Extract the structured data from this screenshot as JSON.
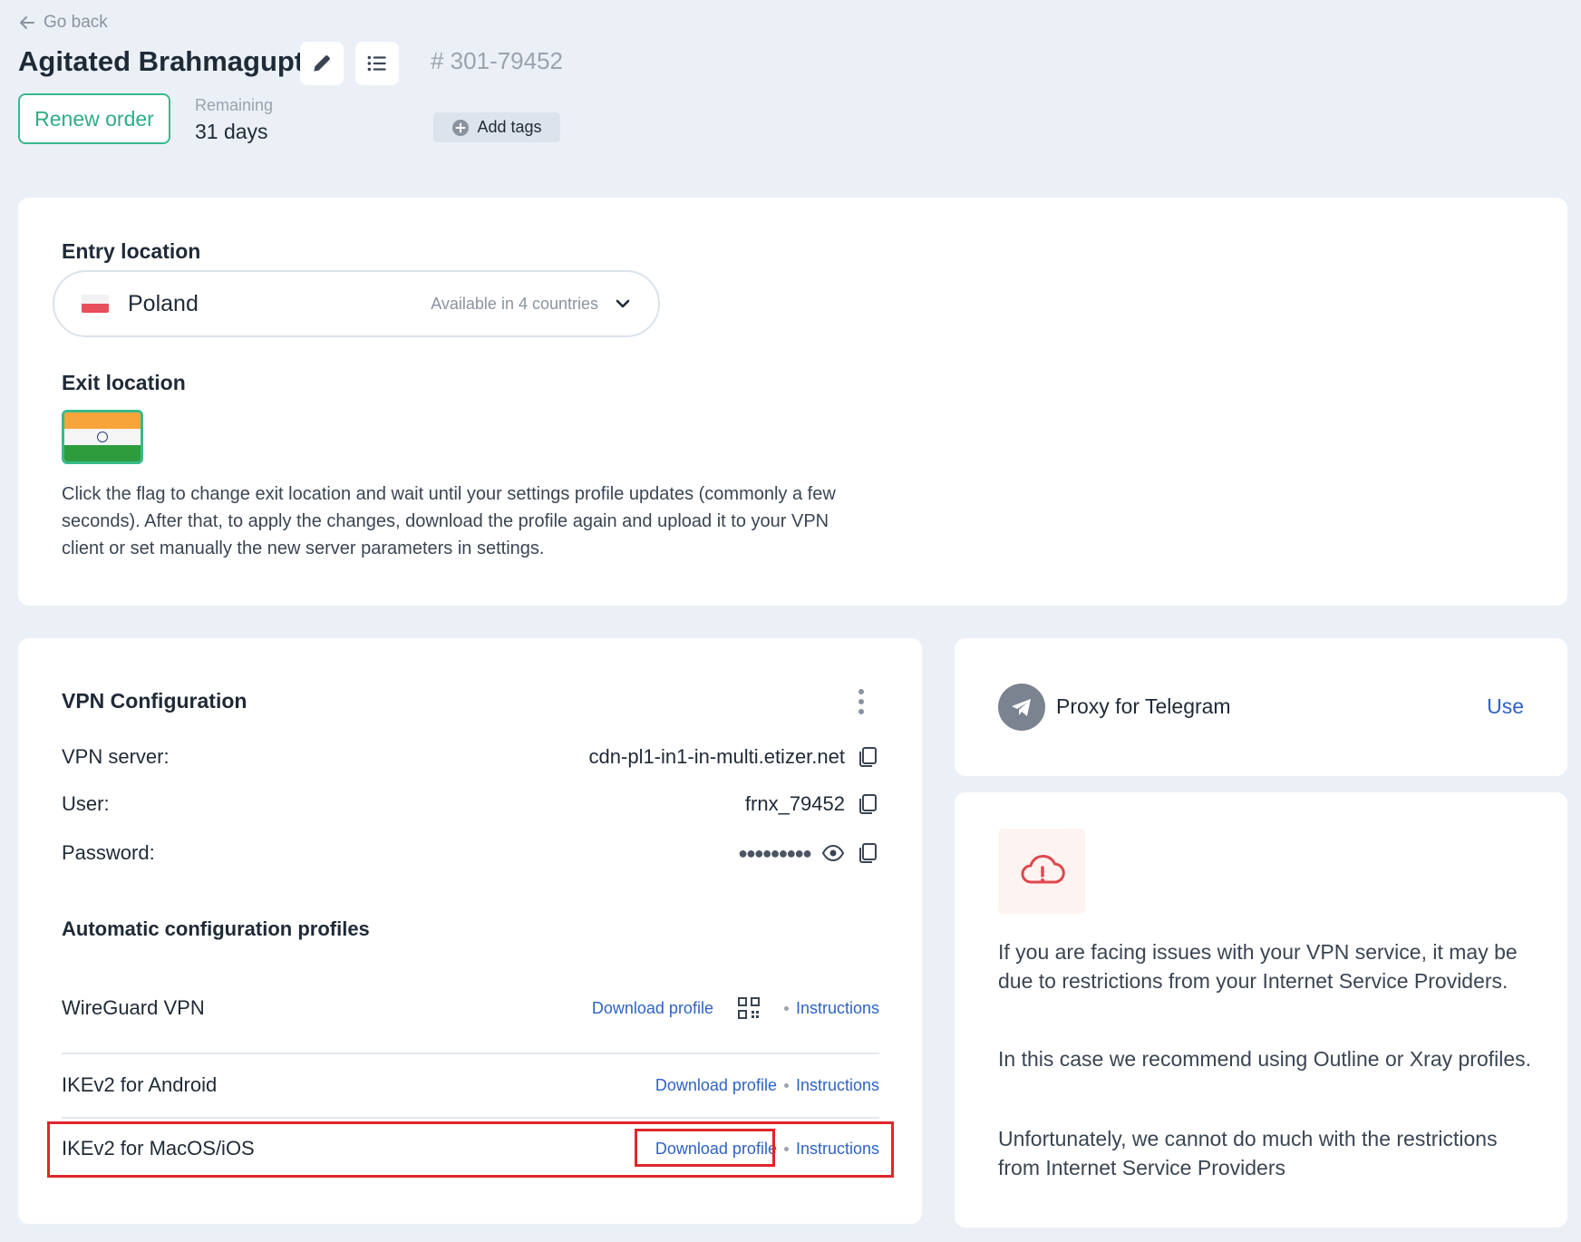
{
  "header": {
    "back_label": "Go back",
    "title": "Agitated Brahmagupta",
    "order_id": "# 301-79452",
    "renew_label": "Renew order",
    "remaining_label": "Remaining",
    "remaining_value": "31 days",
    "add_tags_label": "Add tags"
  },
  "location": {
    "entry_label": "Entry location",
    "entry_country": "Poland",
    "entry_availability": "Available in 4 countries",
    "exit_label": "Exit location",
    "exit_flag": "india-flag",
    "description": "Click the flag to change exit location and wait until your settings profile updates (commonly a few seconds). After that, to apply the changes, download the profile again and upload it to your VPN client or set manually the new server parameters in settings."
  },
  "vpn_config": {
    "title": "VPN Configuration",
    "server_label": "VPN server:",
    "server_value": "cdn-pl1-in1-in-multi.etizer.net",
    "user_label": "User:",
    "user_value": "frnx_79452",
    "password_label": "Password:",
    "password_masked": "●●●●●●●●●",
    "profiles_title": "Automatic configuration profiles",
    "profiles": [
      {
        "name": "WireGuard VPN",
        "download": "Download profile",
        "instructions": "Instructions"
      },
      {
        "name": "IKEv2 for Android",
        "download": "Download profile",
        "instructions": "Instructions"
      },
      {
        "name": "IKEv2 for MacOS/iOS",
        "download": "Download profile",
        "instructions": "Instructions"
      }
    ]
  },
  "telegram": {
    "label": "Proxy for Telegram",
    "use_label": "Use"
  },
  "notice": {
    "p1": "If you are facing issues with your VPN service, it may be due to restrictions from your Internet Service Providers.",
    "p2": "In this case we recommend using Outline or Xray profiles.",
    "p3": "Unfortunately, we cannot do much with the restrictions from Internet Service Providers"
  },
  "colors": {
    "accent_green": "#38b98a",
    "link_blue": "#2e63c2",
    "highlight_red": "#e0262b",
    "background": "#ebf0f7"
  }
}
